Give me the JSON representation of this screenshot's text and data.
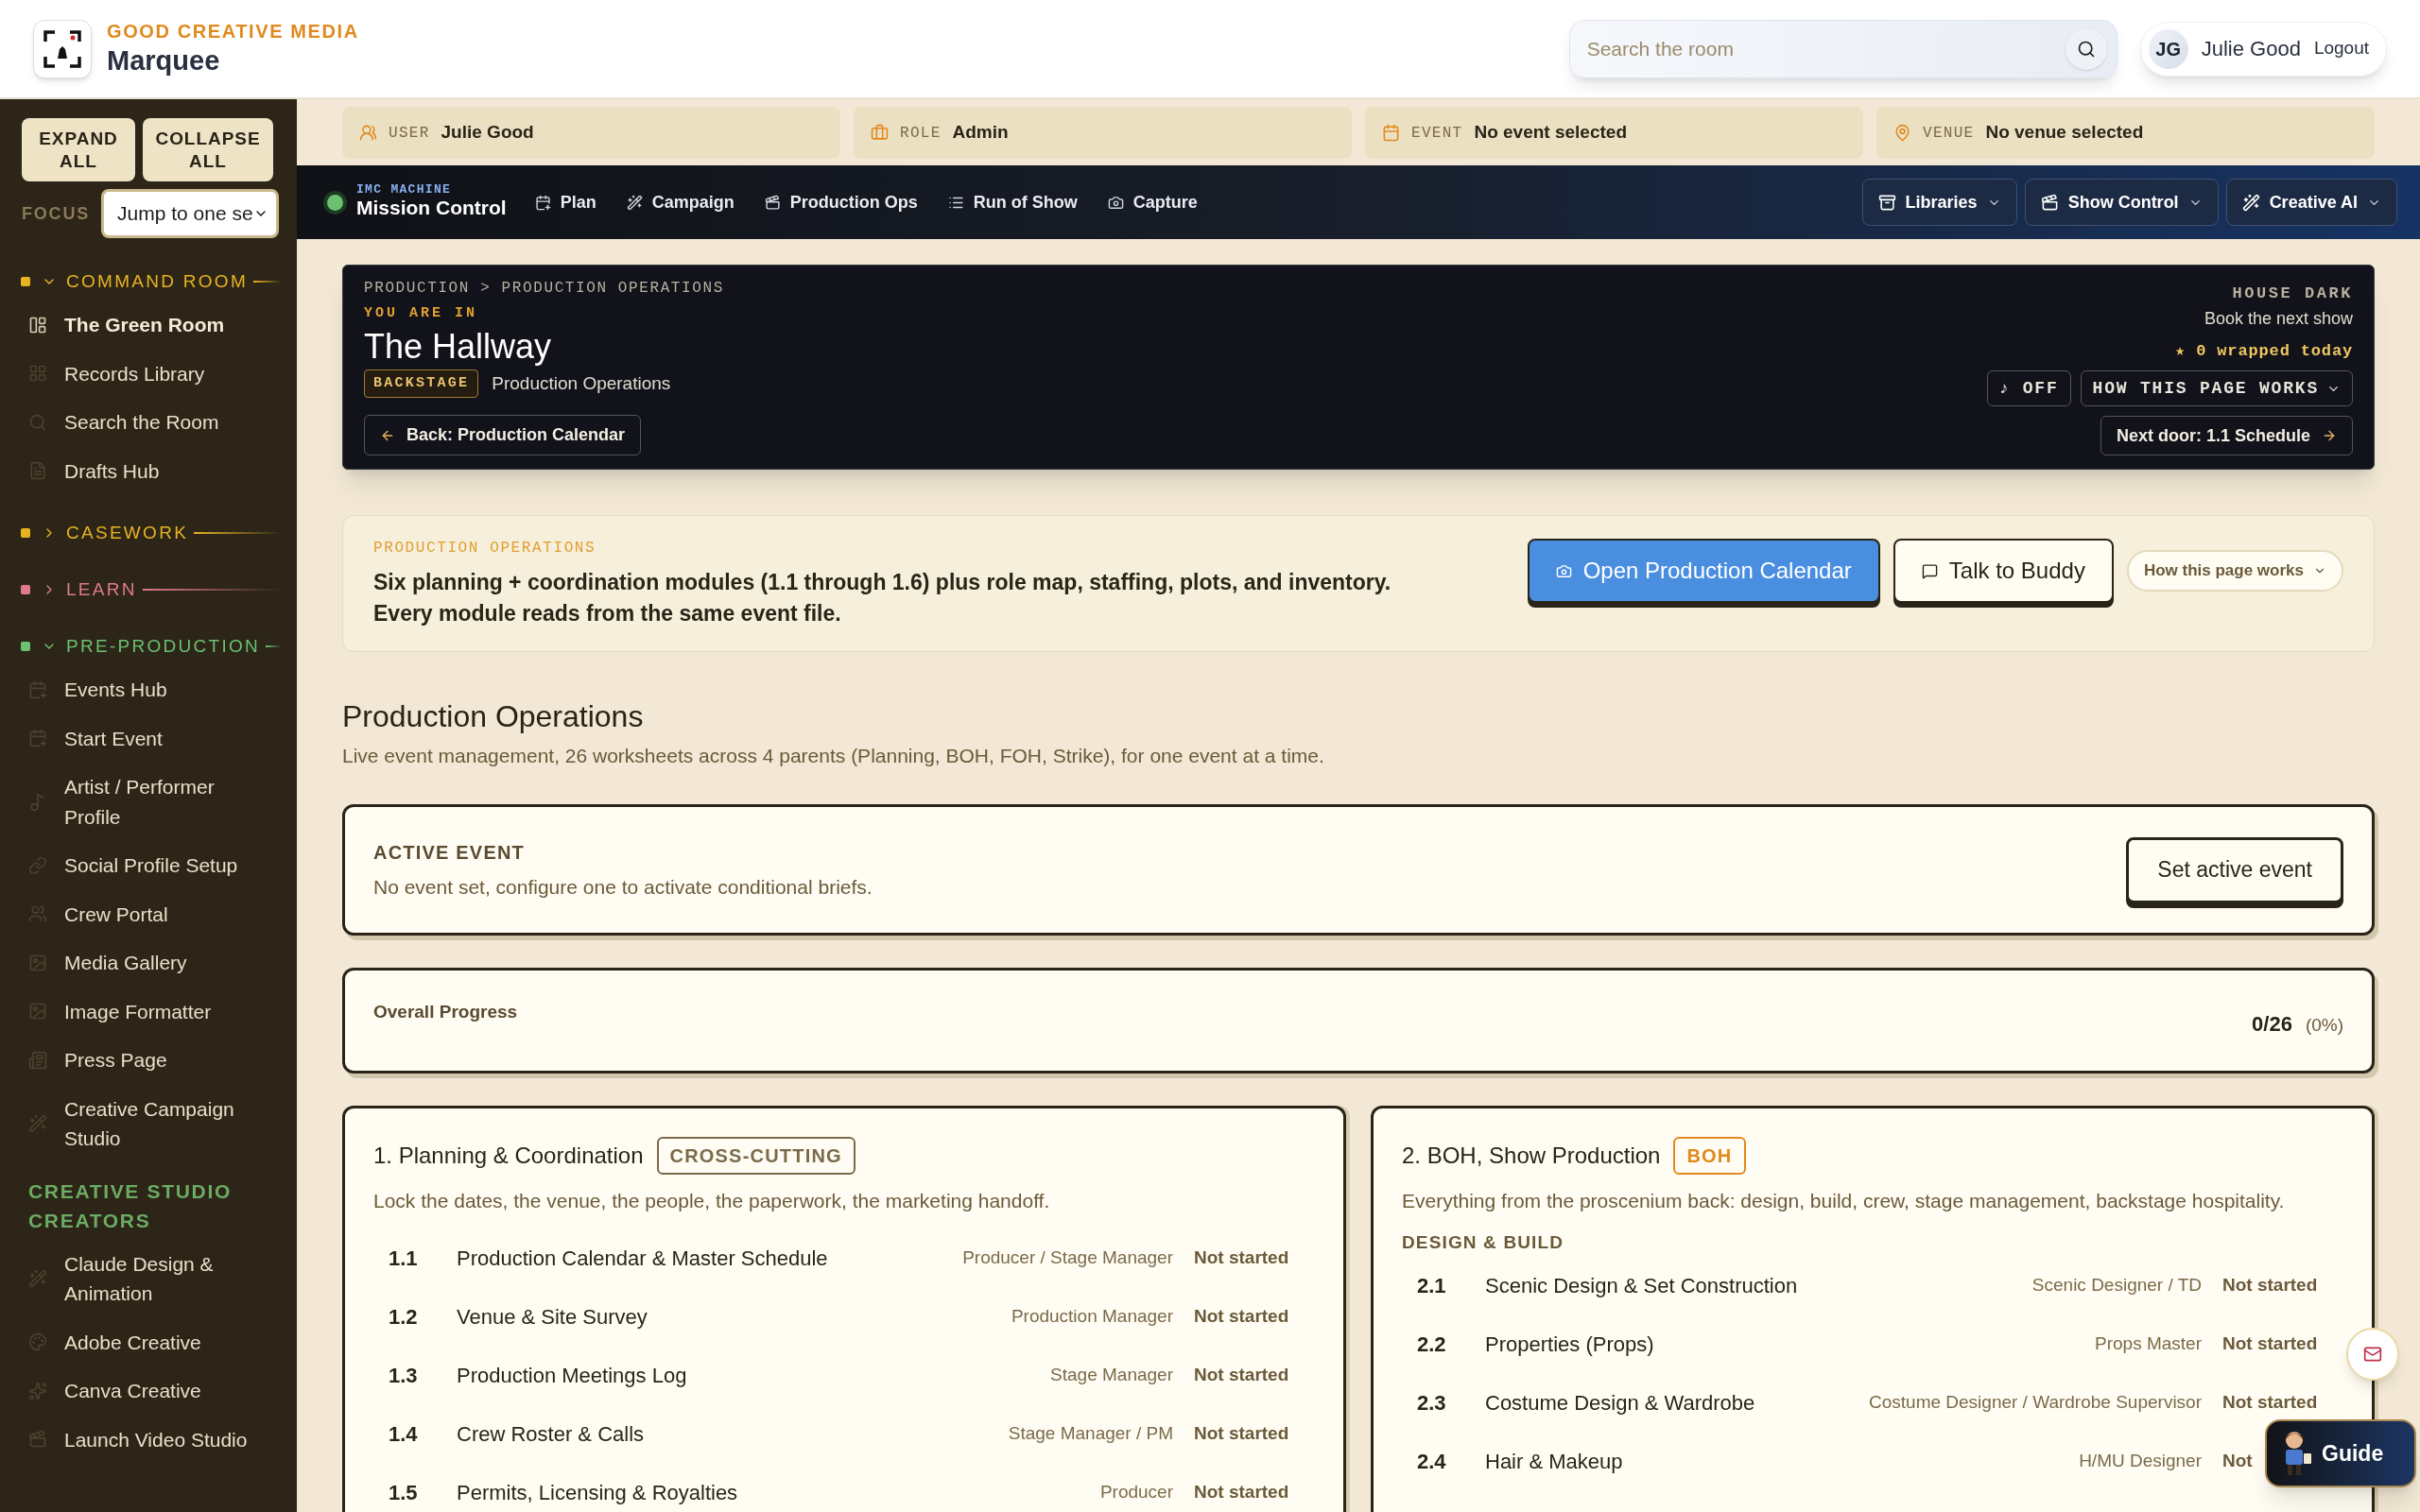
{
  "header": {
    "brand_kicker": "GOOD CREATIVE MEDIA",
    "brand_name": "Marquee",
    "search": {
      "placeholder": "Search the room"
    },
    "user": {
      "initials": "JG",
      "name": "Julie Good",
      "logout": "Logout"
    }
  },
  "sidebar": {
    "expand": "EXPAND ALL",
    "collapse": "COLLAPSE ALL",
    "focus_label": "FOCUS",
    "focus_value": "Jump to one se",
    "sections": [
      {
        "kind": "group",
        "label": "COMMAND ROOM",
        "color": "#e8b320",
        "expanded": true,
        "items": [
          {
            "label": "The Green Room",
            "selected": true
          },
          {
            "label": "Records Library",
            "selected": false
          },
          {
            "label": "Search the Room",
            "selected": false
          },
          {
            "label": "Drafts Hub",
            "selected": false
          }
        ]
      },
      {
        "kind": "group",
        "label": "CASEWORK",
        "color": "#e8b320",
        "expanded": false
      },
      {
        "kind": "group",
        "label": "LEARN",
        "color": "#e07a8a",
        "expanded": false
      },
      {
        "kind": "group",
        "label": "PRE-PRODUCTION",
        "color": "#6cc070",
        "expanded": true,
        "items": [
          {
            "label": "Events Hub",
            "selected": false
          },
          {
            "label": "Start Event",
            "selected": false
          },
          {
            "label": "Artist / Performer Profile",
            "selected": false
          },
          {
            "label": "Social Profile Setup",
            "selected": false
          },
          {
            "label": "Crew Portal",
            "selected": false
          },
          {
            "label": "Media Gallery",
            "selected": false
          },
          {
            "label": "Image Formatter",
            "selected": false
          },
          {
            "label": "Press Page",
            "selected": false
          },
          {
            "label": "Creative Campaign Studio",
            "selected": false
          }
        ]
      },
      {
        "kind": "heading",
        "label": "CREATIVE STUDIO CREATORS",
        "color": "#6cab62",
        "items": [
          {
            "label": "Claude Design & Animation",
            "selected": false
          },
          {
            "label": "Adobe Creative",
            "selected": false
          },
          {
            "label": "Canva Creative",
            "selected": false
          },
          {
            "label": "Launch Video Studio",
            "selected": false
          }
        ]
      }
    ]
  },
  "context_bar": [
    {
      "label": "USER",
      "value": "Julie Good"
    },
    {
      "label": "ROLE",
      "value": "Admin"
    },
    {
      "label": "EVENT",
      "value": "No event selected"
    },
    {
      "label": "VENUE",
      "value": "No venue selected"
    }
  ],
  "nav": {
    "kicker": "IMC MACHINE",
    "title": "Mission Control",
    "online": true,
    "links": [
      "Plan",
      "Campaign",
      "Production Ops",
      "Run of Show",
      "Capture"
    ],
    "menus": [
      "Libraries",
      "Show Control",
      "Creative AI"
    ]
  },
  "hero": {
    "breadcrumb": "PRODUCTION > PRODUCTION OPERATIONS",
    "kicker": "YOU ARE IN",
    "title": "The Hallway",
    "badge": "BACKSTAGE",
    "subtitle": "Production Operations",
    "back": "Back: Production Calendar",
    "mode": "HOUSE DARK",
    "tagline": "Book the next show",
    "wrapped": "★ 0 wrapped today",
    "sound": "♪ OFF",
    "how": "HOW THIS PAGE WORKS",
    "next": "Next door: 1.1 Schedule"
  },
  "intro": {
    "eyebrow": "PRODUCTION OPERATIONS",
    "summary": [
      "Six planning + coordination modules (1.1 through 1.6) plus role map, staffing, plots, and inventory.",
      "Every module reads from the same event file."
    ],
    "primary": "Open Production Calendar",
    "secondary": "Talk to Buddy",
    "how": "How this page works"
  },
  "page": {
    "title": "Production Operations",
    "subtitle": "Live event management, 26 worksheets across 4 parents (Planning, BOH, FOH, Strike), for one event at a time."
  },
  "active_event": {
    "label": "ACTIVE EVENT",
    "text": "No event set, configure one to activate conditional briefs.",
    "button": "Set active event"
  },
  "progress": {
    "label": "Overall Progress",
    "count": "0/26",
    "percent": "(0%)"
  },
  "sections": [
    {
      "title": "1. Planning & Coordination",
      "tag": {
        "label": "CROSS-CUTTING",
        "color": "#7a6a4a"
      },
      "description": "Lock the dates, the venue, the people, the paperwork, the marketing handoff.",
      "groups": [
        {
          "modules": [
            {
              "number": "1.1",
              "title": "Production Calendar & Master Schedule",
              "role": "Producer / Stage Manager",
              "status": "Not started"
            },
            {
              "number": "1.2",
              "title": "Venue & Site Survey",
              "role": "Production Manager",
              "status": "Not started"
            },
            {
              "number": "1.3",
              "title": "Production Meetings Log",
              "role": "Stage Manager",
              "status": "Not started"
            },
            {
              "number": "1.4",
              "title": "Crew Roster & Calls",
              "role": "Stage Manager / PM",
              "status": "Not started"
            },
            {
              "number": "1.5",
              "title": "Permits, Licensing & Royalties",
              "role": "Producer",
              "status": "Not started"
            }
          ]
        }
      ]
    },
    {
      "title": "2. BOH, Show Production",
      "tag": {
        "label": "BOH",
        "color": "#e08a1e"
      },
      "description": "Everything from the proscenium back: design, build, crew, stage management, backstage hospitality.",
      "groups": [
        {
          "label": "DESIGN & BUILD",
          "modules": [
            {
              "number": "2.1",
              "title": "Scenic Design & Set Construction",
              "role": "Scenic Designer / TD",
              "status": "Not started"
            },
            {
              "number": "2.2",
              "title": "Properties (Props)",
              "role": "Props Master",
              "status": "Not started"
            },
            {
              "number": "2.3",
              "title": "Costume Design & Wardrobe",
              "role": "Costume Designer / Wardrobe Supervisor",
              "status": "Not started"
            },
            {
              "number": "2.4",
              "title": "Hair & Makeup",
              "role": "H/MU Designer",
              "status": "Not"
            }
          ]
        }
      ]
    }
  ],
  "guide": {
    "label": "Guide"
  }
}
